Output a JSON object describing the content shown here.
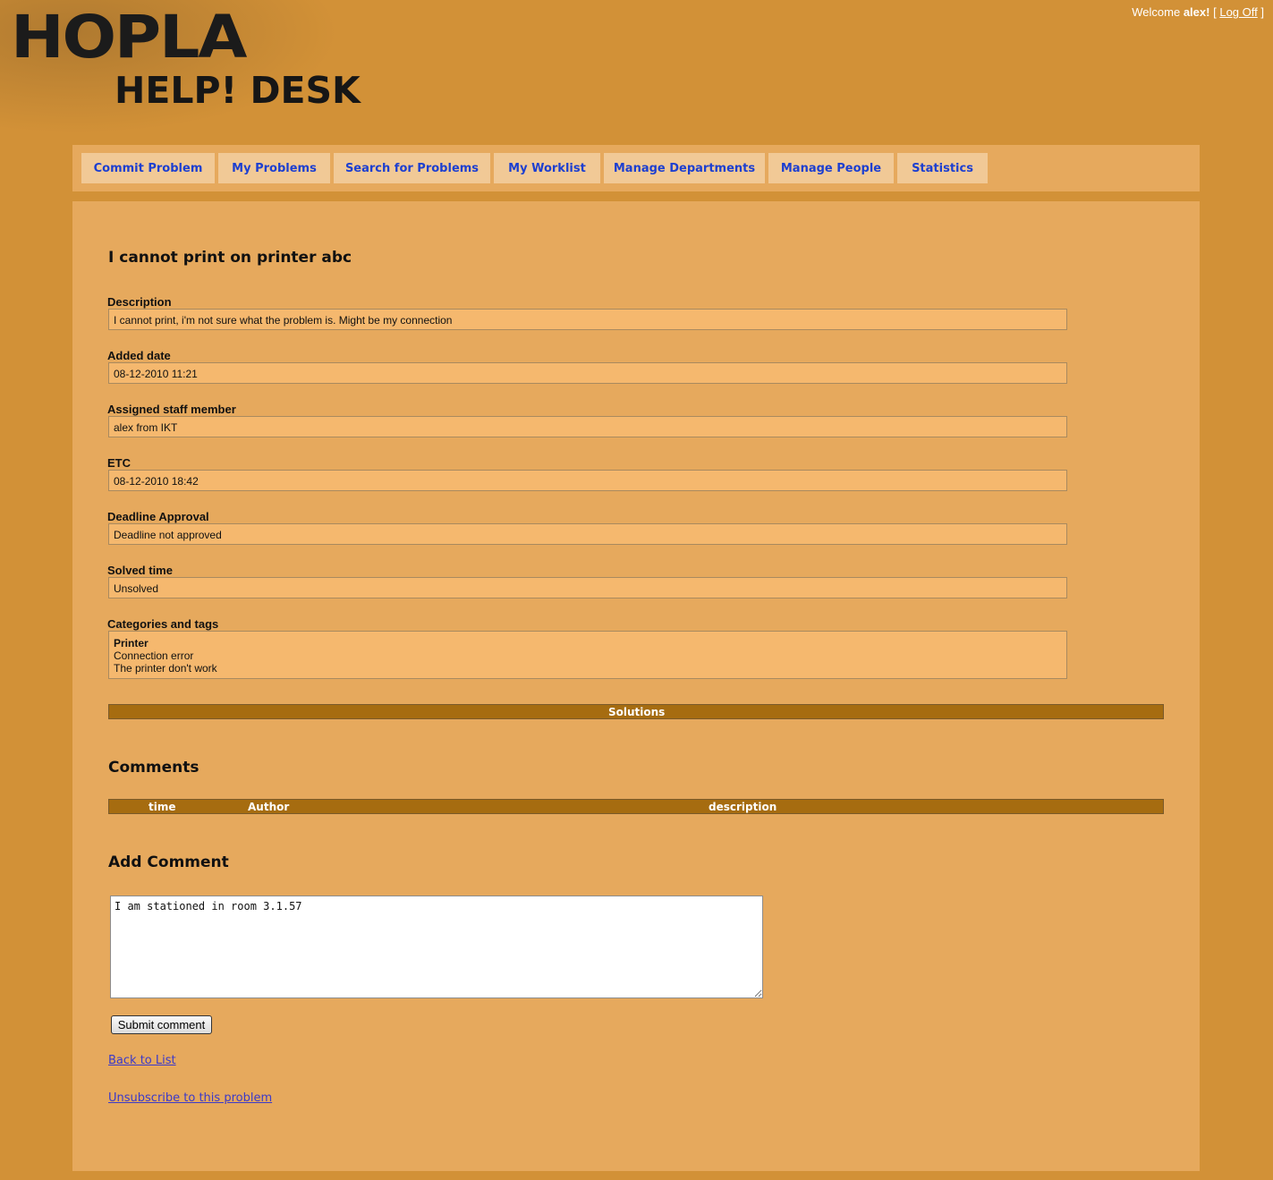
{
  "header": {
    "logo_top": "HOPLA",
    "logo_bottom": "HELP! DESK",
    "welcome_prefix": "Welcome",
    "username": "alex!",
    "bracket_open": "[",
    "logoff_label": "Log Off",
    "bracket_close": "]"
  },
  "menu": {
    "items": [
      {
        "label": "Commit Problem"
      },
      {
        "label": "My Problems"
      },
      {
        "label": "Search for Problems"
      },
      {
        "label": "My Worklist"
      },
      {
        "label": "Manage Departments"
      },
      {
        "label": "Manage People"
      },
      {
        "label": "Statistics"
      }
    ]
  },
  "problem": {
    "title": "I cannot print on printer abc",
    "fields": [
      {
        "label": "Description",
        "value": "I cannot print, i'm not sure what the problem is. Might be my connection"
      },
      {
        "label": "Added date",
        "value": "08-12-2010 11:21"
      },
      {
        "label": "Assigned staff member",
        "value": "alex from IKT"
      },
      {
        "label": "ETC",
        "value": "08-12-2010 18:42"
      },
      {
        "label": "Deadline Approval",
        "value": "Deadline not approved"
      },
      {
        "label": "Solved time",
        "value": "Unsolved"
      }
    ],
    "categories_label": "Categories and tags",
    "category": "Printer",
    "tags": [
      "Connection error",
      "The printer don't work"
    ]
  },
  "solutions": {
    "header": "Solutions"
  },
  "comments": {
    "heading": "Comments",
    "columns": [
      "time",
      "Author",
      "description"
    ]
  },
  "add_comment": {
    "heading": "Add Comment",
    "text": "I am stationed in room 3.1.57",
    "submit_label": "Submit comment"
  },
  "links": {
    "back": "Back to List",
    "unsubscribe": "Unsubscribe to this problem"
  }
}
